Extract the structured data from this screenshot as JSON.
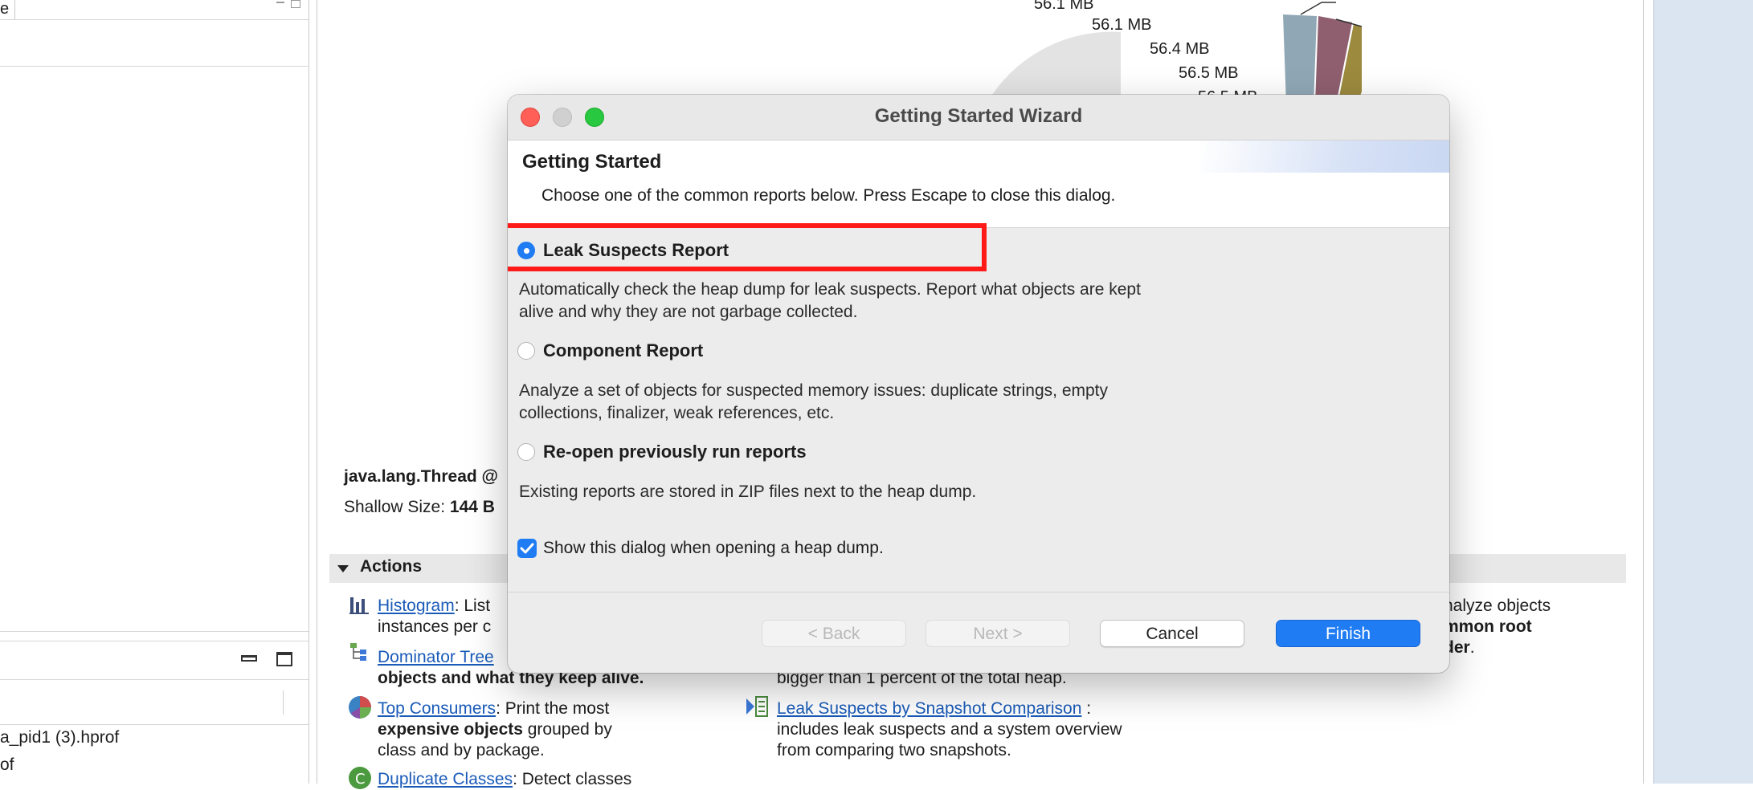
{
  "left_panel": {
    "top_fragment": "e",
    "files": [
      "a_pid1 (3).hprof",
      "of"
    ]
  },
  "editor": {
    "pie_labels": [
      "56.1 MB",
      "56.1 MB",
      "56.4 MB",
      "56.5 MB",
      "56.5 MB"
    ],
    "object_title": "java.lang.Thread @",
    "shallow_size_label": "Shallow Size:",
    "shallow_size_value": "144 B",
    "actions_header": "Actions",
    "actions": [
      {
        "link": "Histogram",
        "text1": ": List",
        "text2": "instances per c",
        "icon": "histogram-icon"
      },
      {
        "link": "Dominator Tree",
        "text2": "objects and what they keep alive.",
        "icon": "dominator-tree-icon"
      },
      {
        "link": "Top Consumers",
        "text1": ": Print the most",
        "text2_bold": "expensive objects",
        "text2": " grouped by",
        "text3": "class and by package.",
        "icon": "top-consumers-icon"
      },
      {
        "link": "Duplicate Classes",
        "text1": ": Detect classes",
        "icon": "duplicate-classes-icon"
      }
    ],
    "mid_text": "bigger than 1 percent of the total heap.",
    "snapshot_link": "Leak Suspects by Snapshot Comparison",
    "snapshot_suffix": ":",
    "snapshot_line2": "includes leak suspects and a system overview",
    "snapshot_line3": "from comparing two snapshots.",
    "right_text1": "nalyze objects",
    "right_text2": "mmon root",
    "right_text3": "der",
    "right_text3_suffix": "."
  },
  "dialog": {
    "title": "Getting Started Wizard",
    "heading": "Getting Started",
    "subheading": "Choose one of the common reports below. Press Escape to close this dialog.",
    "options": [
      {
        "label": "Leak Suspects Report",
        "selected": true,
        "desc_line1": "Automatically check the heap dump for leak suspects. Report what objects are kept",
        "desc_line2": "alive and why they are not garbage collected."
      },
      {
        "label": "Component Report",
        "selected": false,
        "desc_line1": "Analyze a set of objects for suspected memory issues: duplicate strings, empty",
        "desc_line2": "collections, finalizer, weak references, etc."
      },
      {
        "label": "Re-open previously run reports",
        "selected": false,
        "desc_line1": "Existing reports are stored in ZIP files next to the heap dump.",
        "desc_line2": ""
      }
    ],
    "checkbox_label": "Show this dialog when opening a heap dump.",
    "checkbox_checked": true,
    "buttons": {
      "back": "< Back",
      "next": "Next >",
      "cancel": "Cancel",
      "finish": "Finish"
    }
  },
  "colors": {
    "accent": "#1f7cf3",
    "highlight": "#ff1a1a",
    "link": "#1a5bb8"
  }
}
